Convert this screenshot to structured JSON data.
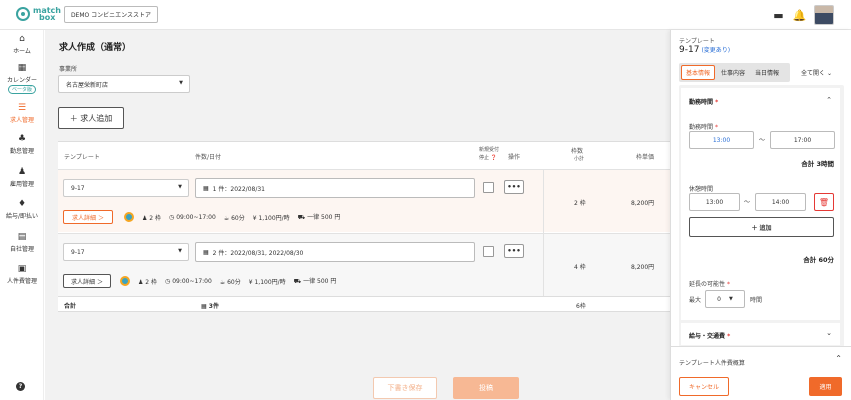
{
  "header": {
    "logo_line1": "match",
    "logo_line2": "box",
    "store": "DEMO コンビニエンスストア"
  },
  "sidebar": {
    "items": [
      {
        "icon": "⌂",
        "label": "ホーム"
      },
      {
        "icon": "▦",
        "label": "カレンダー",
        "badge": "ベータ版"
      },
      {
        "icon": "☰",
        "label": "求人管理"
      },
      {
        "icon": "♣",
        "label": "勤怠管理"
      },
      {
        "icon": "♟",
        "label": "雇用管理"
      },
      {
        "icon": "♦",
        "label": "給与/即払い"
      },
      {
        "icon": "▤",
        "label": "自社管理"
      },
      {
        "icon": "▣",
        "label": "人件費管理"
      }
    ],
    "help": "?"
  },
  "main": {
    "title": "求人作成（通常）",
    "office_label": "事業所",
    "office_value": "名古屋栄新町店",
    "add_button": "＋ 求人追加",
    "columns": {
      "template": "テンプレート",
      "dates": "件数/日付",
      "new_stop1": "新規受付",
      "new_stop2": "停止 ❓",
      "actions": "操作",
      "slots": "枠数",
      "slots_sub": "小計",
      "unit": "枠単価"
    },
    "rows": [
      {
        "template": "9-17",
        "dates": "1 件：2022/08/31",
        "detail": "求人詳細 ＞",
        "slots": "2 枠",
        "time": "09:00~17:00",
        "rest": "60分",
        "wage": "1,100円/時",
        "trans": "一律 500 円",
        "slots_total": "2 枠",
        "unit_price": "8,200円"
      },
      {
        "template": "9-17",
        "dates": "2 件：2022/08/31, 2022/08/30",
        "detail": "求人詳細 ＞",
        "slots": "2 枠",
        "time": "09:00~17:00",
        "rest": "60分",
        "wage": "1,100円/時",
        "trans": "一律 500 円",
        "slots_total": "4 枠",
        "unit_price": "8,200円"
      }
    ],
    "sum_label": "合計",
    "sum_count": "3件",
    "sum_slots": "6枠",
    "draft_button": "下書き保存",
    "post_button": "投稿"
  },
  "panel": {
    "title": "テンプレート",
    "name": "9-17",
    "changed": "(変更あり)",
    "tabs": [
      "基本情報",
      "仕事内容",
      "当日情報"
    ],
    "open_all": "全て開く",
    "work_section": "勤務時間",
    "work_time_label": "勤務時間",
    "start": "13:00",
    "end": "17:00",
    "tilde": "〜",
    "work_total": "合計 3時間",
    "break_label": "休憩時間",
    "break_start": "13:00",
    "break_end": "14:00",
    "add_break": "＋ 追加",
    "break_total": "合計 60分",
    "extend_label": "延長の可能性",
    "max_label": "最大",
    "max_value": "0",
    "hours": "時間",
    "pay_section": "給与・交通費",
    "cost_section": "テンプレート人件費概算",
    "cancel": "キャンセル",
    "apply": "適用"
  },
  "colors": {
    "accent": "#f06a2a",
    "teal": "#3aa3a0"
  }
}
